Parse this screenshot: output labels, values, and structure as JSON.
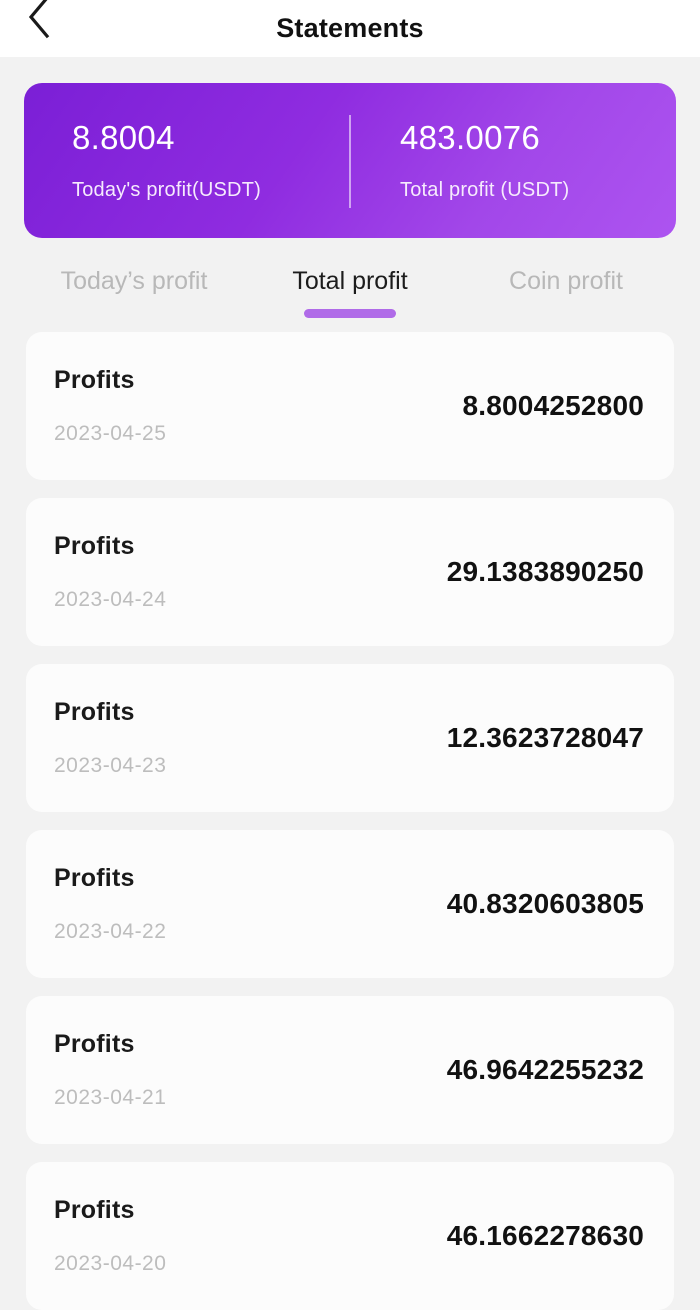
{
  "header": {
    "title": "Statements",
    "back_icon": "chevron-left-icon"
  },
  "summary": {
    "today": {
      "value": "8.8004",
      "label": "Today's profit(USDT)"
    },
    "total": {
      "value": "483.0076",
      "label": "Total profit (USDT)"
    },
    "gradient_from": "#7b1fd6",
    "gradient_to": "#ad54f0"
  },
  "tabs": {
    "active_index": 1,
    "accent_color": "#b06be8",
    "items": [
      {
        "label": "Today’s profit"
      },
      {
        "label": "Total profit"
      },
      {
        "label": "Coin profit"
      }
    ]
  },
  "list": {
    "rows": [
      {
        "title": "Profits",
        "date": "2023-04-25",
        "amount": "8.8004252800"
      },
      {
        "title": "Profits",
        "date": "2023-04-24",
        "amount": "29.1383890250"
      },
      {
        "title": "Profits",
        "date": "2023-04-23",
        "amount": "12.3623728047"
      },
      {
        "title": "Profits",
        "date": "2023-04-22",
        "amount": "40.8320603805"
      },
      {
        "title": "Profits",
        "date": "2023-04-21",
        "amount": "46.9642255232"
      },
      {
        "title": "Profits",
        "date": "2023-04-20",
        "amount": "46.1662278630"
      }
    ]
  }
}
